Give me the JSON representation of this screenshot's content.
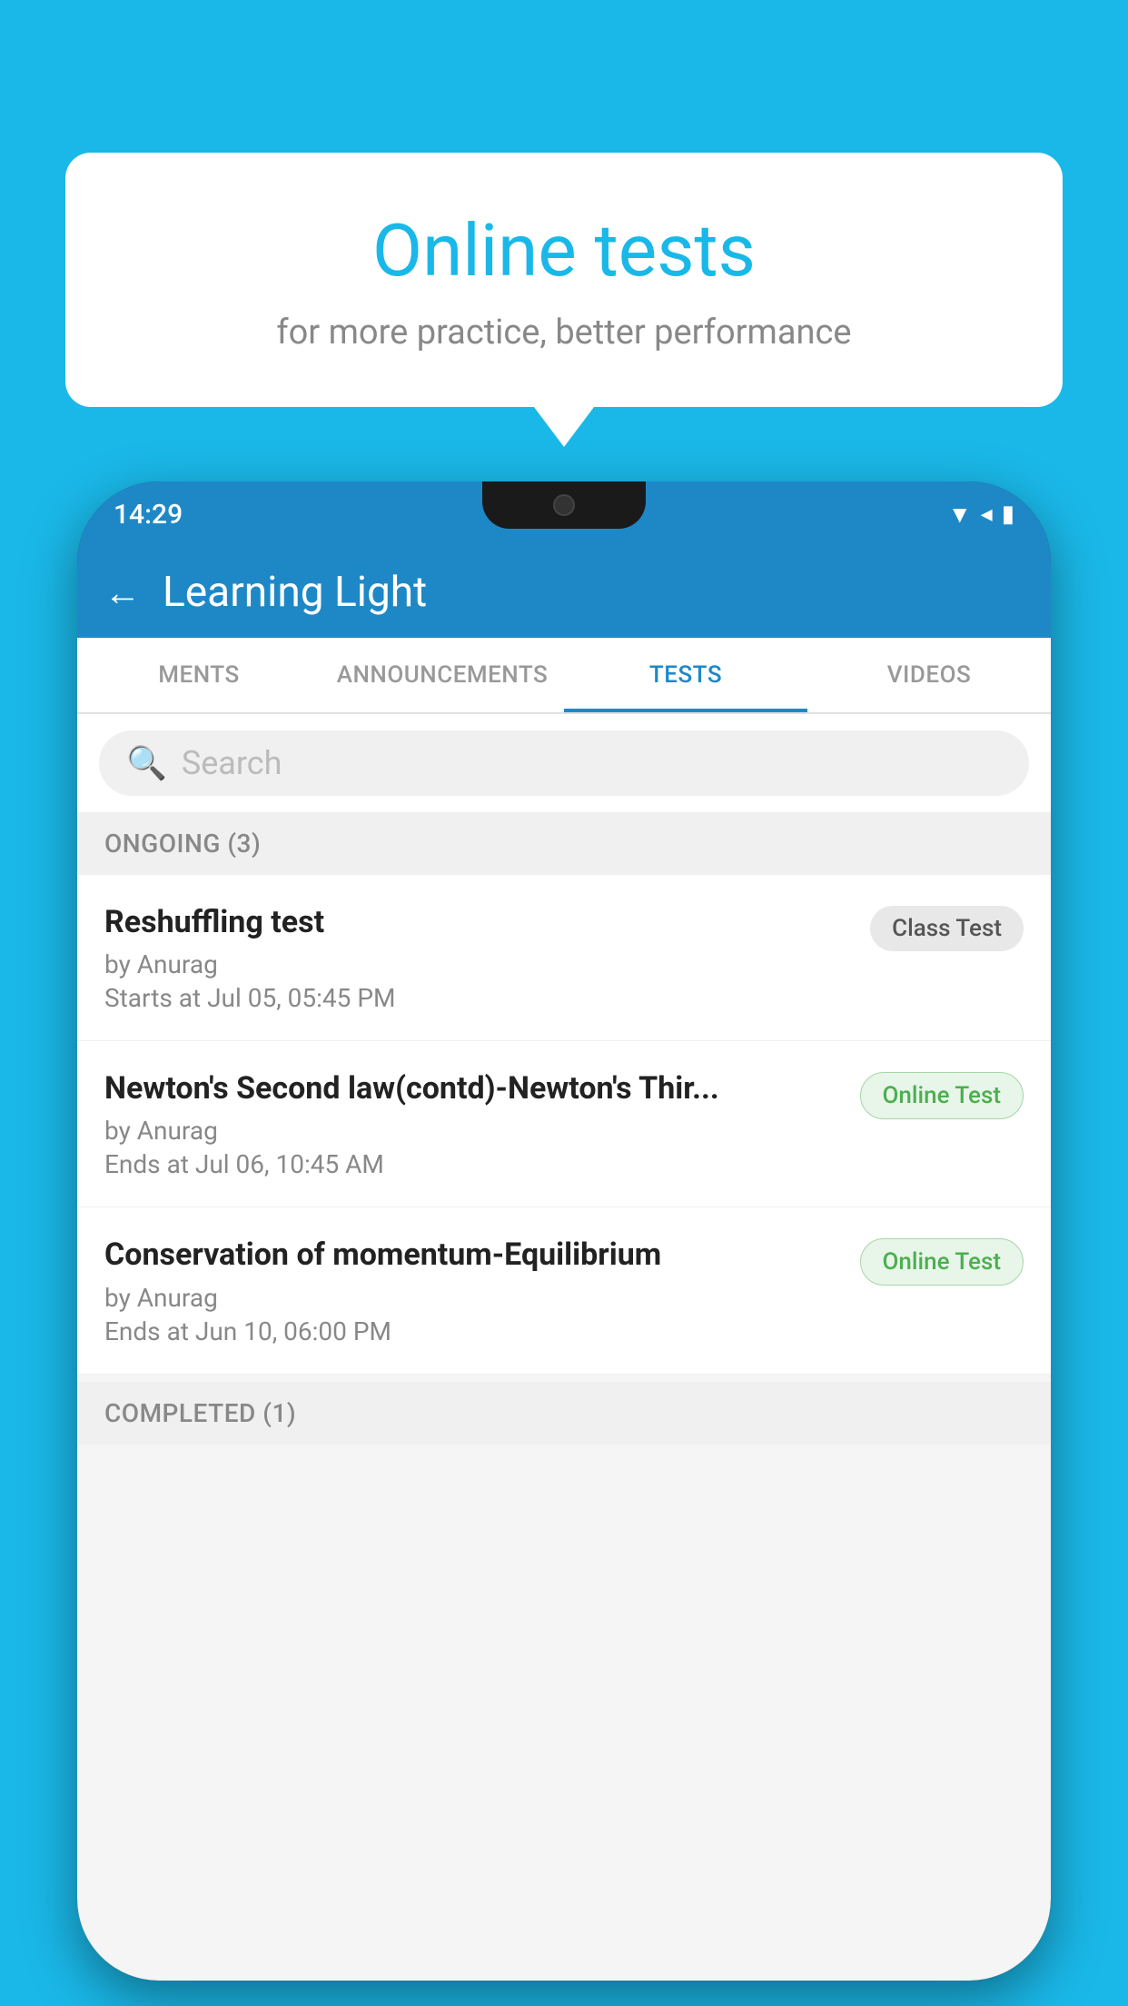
{
  "background_color": "#1ab8e8",
  "speech_bubble": {
    "title": "Online tests",
    "subtitle": "for more practice, better performance"
  },
  "phone": {
    "status_bar": {
      "time": "14:29",
      "icons": "▼◂▮"
    },
    "nav_bar": {
      "back_label": "←",
      "title": "Learning Light"
    },
    "tabs": [
      {
        "label": "MENTS",
        "active": false
      },
      {
        "label": "ANNOUNCEMENTS",
        "active": false
      },
      {
        "label": "TESTS",
        "active": true
      },
      {
        "label": "VIDEOS",
        "active": false
      }
    ],
    "search": {
      "placeholder": "Search"
    },
    "section_ongoing": {
      "label": "ONGOING (3)"
    },
    "tests": [
      {
        "name": "Reshuffling test",
        "by": "by Anurag",
        "date_label": "Starts at",
        "date": "Jul 05, 05:45 PM",
        "badge": "Class Test",
        "badge_type": "class"
      },
      {
        "name": "Newton's Second law(contd)-Newton's Thir...",
        "by": "by Anurag",
        "date_label": "Ends at",
        "date": "Jul 06, 10:45 AM",
        "badge": "Online Test",
        "badge_type": "online"
      },
      {
        "name": "Conservation of momentum-Equilibrium",
        "by": "by Anurag",
        "date_label": "Ends at",
        "date": "Jun 10, 06:00 PM",
        "badge": "Online Test",
        "badge_type": "online"
      }
    ],
    "section_completed": {
      "label": "COMPLETED (1)"
    }
  }
}
